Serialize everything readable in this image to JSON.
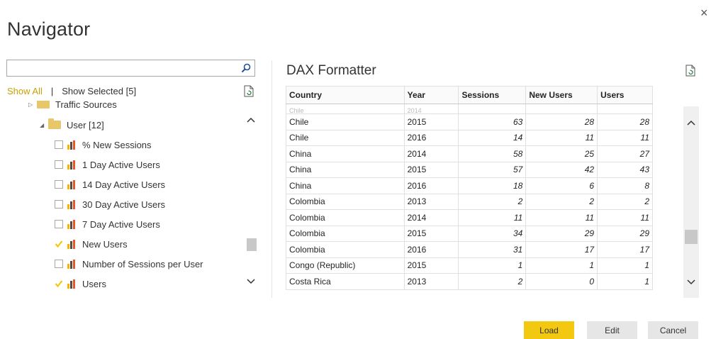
{
  "window": {
    "title": "Navigator",
    "close_glyph": "×"
  },
  "search": {
    "value": "",
    "placeholder": "",
    "icon": "search-icon"
  },
  "filter": {
    "show_all": "Show All",
    "separator": "|",
    "show_selected": "Show Selected [5]"
  },
  "tree": {
    "partial_folder": "Traffic Sources",
    "folder": "User [12]",
    "items": [
      {
        "label": "% New Sessions",
        "checked": false
      },
      {
        "label": "1 Day Active Users",
        "checked": false
      },
      {
        "label": "14 Day Active Users",
        "checked": false
      },
      {
        "label": "30 Day Active Users",
        "checked": false
      },
      {
        "label": "7 Day Active Users",
        "checked": false
      },
      {
        "label": "New Users",
        "checked": true
      },
      {
        "label": "Number of Sessions per User",
        "checked": false
      },
      {
        "label": "Users",
        "checked": true
      }
    ]
  },
  "preview": {
    "title": "DAX Formatter",
    "columns": [
      "Country",
      "Year",
      "Sessions",
      "New Users",
      "Users"
    ],
    "partial_row": [
      "Chile",
      "2014",
      "",
      "",
      ""
    ],
    "rows": [
      [
        "Chile",
        "2015",
        "63",
        "28",
        "28"
      ],
      [
        "Chile",
        "2016",
        "14",
        "11",
        "11"
      ],
      [
        "China",
        "2014",
        "58",
        "25",
        "27"
      ],
      [
        "China",
        "2015",
        "57",
        "42",
        "43"
      ],
      [
        "China",
        "2016",
        "18",
        "6",
        "8"
      ],
      [
        "Colombia",
        "2013",
        "2",
        "2",
        "2"
      ],
      [
        "Colombia",
        "2014",
        "11",
        "11",
        "11"
      ],
      [
        "Colombia",
        "2015",
        "34",
        "29",
        "29"
      ],
      [
        "Colombia",
        "2016",
        "31",
        "17",
        "17"
      ],
      [
        "Congo (Republic)",
        "2015",
        "1",
        "1",
        "1"
      ],
      [
        "Costa Rica",
        "2013",
        "2",
        "0",
        "1"
      ]
    ]
  },
  "buttons": {
    "load": "Load",
    "edit": "Edit",
    "cancel": "Cancel"
  },
  "colors": {
    "accent": "#f2c811",
    "show_all": "#c8a200",
    "check": "#f2c811"
  }
}
